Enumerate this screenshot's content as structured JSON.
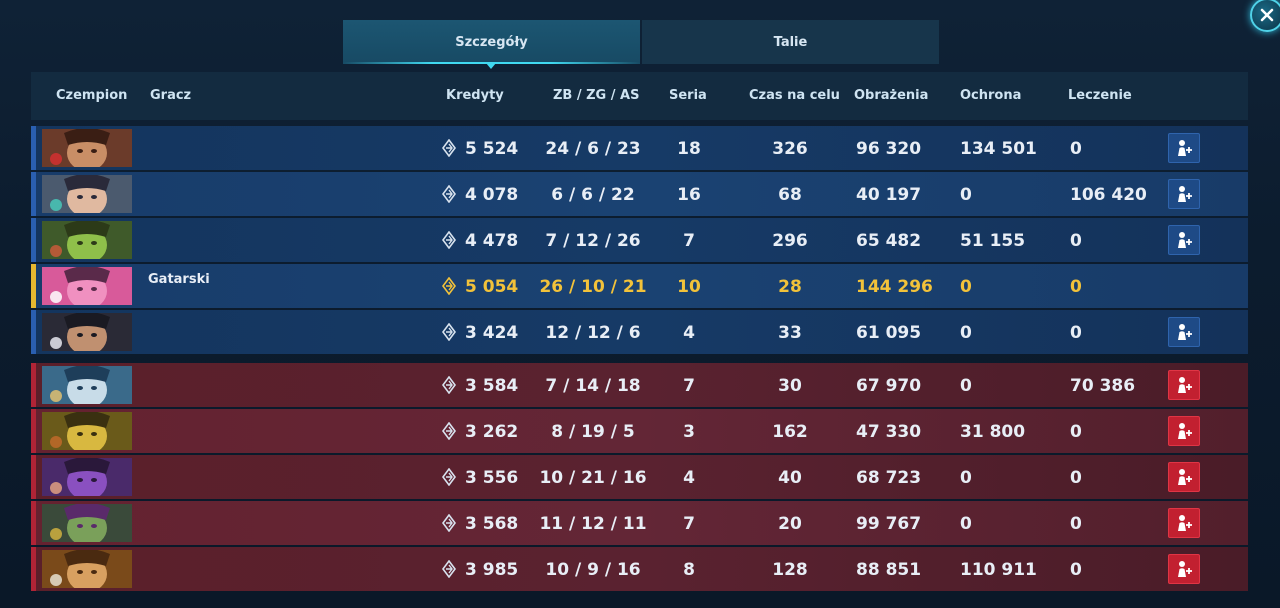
{
  "tabs": [
    {
      "label": "Szczegóły",
      "active": true
    },
    {
      "label": "Talie",
      "active": false
    }
  ],
  "headers": {
    "champion": "Czempion",
    "player": "Gracz",
    "credits": "Kredyty",
    "kda": "ZB / ZG / AS",
    "streak": "Seria",
    "objective": "Czas na celu",
    "damage": "Obrażenia",
    "shielding": "Ochrona",
    "healing": "Leczenie"
  },
  "colors": {
    "team_blue": "#163a66",
    "team_red": "#5a2230",
    "highlight_gold": "#f2c23a",
    "accent_cyan": "#40d8f0"
  },
  "team_blue": [
    {
      "champion": "champion-portrait-1",
      "player": "",
      "credits": "5 524",
      "kda": "24 / 6 / 23",
      "streak": "18",
      "objective": "326",
      "damage": "96 320",
      "shielding": "134 501",
      "healing": "0",
      "invite": true
    },
    {
      "champion": "champion-portrait-2",
      "player": "",
      "credits": "4 078",
      "kda": "6 / 6 / 22",
      "streak": "16",
      "objective": "68",
      "damage": "40 197",
      "shielding": "0",
      "healing": "106 420",
      "invite": true
    },
    {
      "champion": "champion-portrait-3",
      "player": "",
      "credits": "4 478",
      "kda": "7 / 12 / 26",
      "streak": "7",
      "objective": "296",
      "damage": "65 482",
      "shielding": "51 155",
      "healing": "0",
      "invite": true
    },
    {
      "champion": "champion-portrait-4",
      "player": "Gatarski",
      "credits": "5 054",
      "kda": "26 / 10 / 21",
      "streak": "10",
      "objective": "28",
      "damage": "144 296",
      "shielding": "0",
      "healing": "0",
      "invite": false,
      "me": true
    },
    {
      "champion": "champion-portrait-5",
      "player": "",
      "credits": "3 424",
      "kda": "12 / 12 / 6",
      "streak": "4",
      "objective": "33",
      "damage": "61 095",
      "shielding": "0",
      "healing": "0",
      "invite": true
    }
  ],
  "team_red": [
    {
      "champion": "champion-portrait-6",
      "player": "",
      "credits": "3 584",
      "kda": "7 / 14 / 18",
      "streak": "7",
      "objective": "30",
      "damage": "67 970",
      "shielding": "0",
      "healing": "70 386",
      "invite": true
    },
    {
      "champion": "champion-portrait-7",
      "player": "",
      "credits": "3 262",
      "kda": "8 / 19 / 5",
      "streak": "3",
      "objective": "162",
      "damage": "47 330",
      "shielding": "31 800",
      "healing": "0",
      "invite": true
    },
    {
      "champion": "champion-portrait-8",
      "player": "",
      "credits": "3 556",
      "kda": "10 / 21 / 16",
      "streak": "4",
      "objective": "40",
      "damage": "68 723",
      "shielding": "0",
      "healing": "0",
      "invite": true
    },
    {
      "champion": "champion-portrait-9",
      "player": "",
      "credits": "3 568",
      "kda": "11 / 12 / 11",
      "streak": "7",
      "objective": "20",
      "damage": "99 767",
      "shielding": "0",
      "healing": "0",
      "invite": true
    },
    {
      "champion": "champion-portrait-10",
      "player": "",
      "credits": "3 985",
      "kda": "10 / 9 / 16",
      "streak": "8",
      "objective": "128",
      "damage": "88 851",
      "shielding": "110 911",
      "healing": "0",
      "invite": true
    }
  ]
}
